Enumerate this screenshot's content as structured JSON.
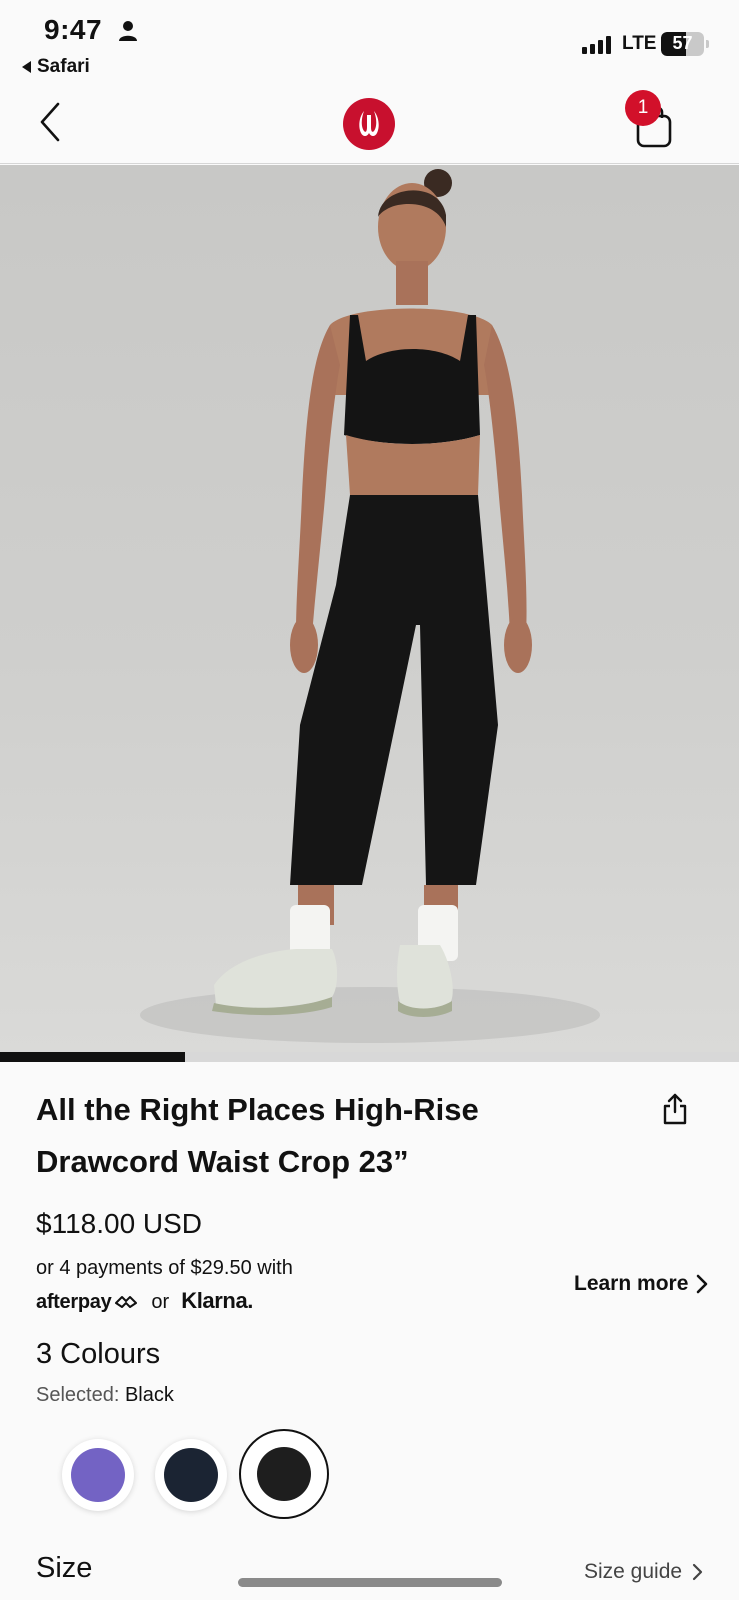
{
  "status_bar": {
    "time": "9:47",
    "back_app": "Safari",
    "network": "LTE",
    "battery": "57",
    "battery_level": 0.57
  },
  "nav": {
    "cart_count": "1",
    "brand_color": "#c8102e"
  },
  "carousel": {
    "progress": 0.25
  },
  "product": {
    "title_line1": "All the Right Places High-Rise",
    "title_line2": "Drawcord Waist Crop 23”",
    "price": "$118.00 USD",
    "installments": "or 4 payments of $29.50 with",
    "afterpay": "afterpay",
    "or": "or",
    "klarna": "Klarna.",
    "learn_more": "Learn more"
  },
  "colours": {
    "heading": "3 Colours",
    "selected_label": "Selected:",
    "selected_value": "Black",
    "swatches": [
      {
        "name": "purple",
        "color": "#7363c4"
      },
      {
        "name": "navy",
        "color": "#1b2433"
      },
      {
        "name": "black",
        "color": "#1e1e1e",
        "selected": true
      }
    ]
  },
  "size": {
    "heading": "Size",
    "guide": "Size guide"
  }
}
